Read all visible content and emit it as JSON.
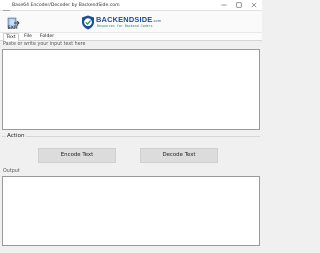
{
  "window": {
    "title": "Base64 Encoder/Decoder by BackendSide.com"
  },
  "banner": {
    "exit_label": "EXIT",
    "logo_name": "BACKENDSIDE",
    "logo_suffix": ".com",
    "logo_tagline": "Resources for Backend Coders"
  },
  "tabs": [
    {
      "label": "Text",
      "active": true
    },
    {
      "label": "File",
      "active": false
    },
    {
      "label": "Folder",
      "active": false
    }
  ],
  "input": {
    "caption": "Paste or write your input text here",
    "value": ""
  },
  "action": {
    "legend": "Action",
    "encode_label": "Encode Text",
    "decode_label": "Decode Text"
  },
  "output": {
    "caption": "Output",
    "value": ""
  },
  "colors": {
    "logo_blue": "#1b4d9b",
    "logo_green": "#2a8a55",
    "button_gray": "#dcdcdc"
  }
}
